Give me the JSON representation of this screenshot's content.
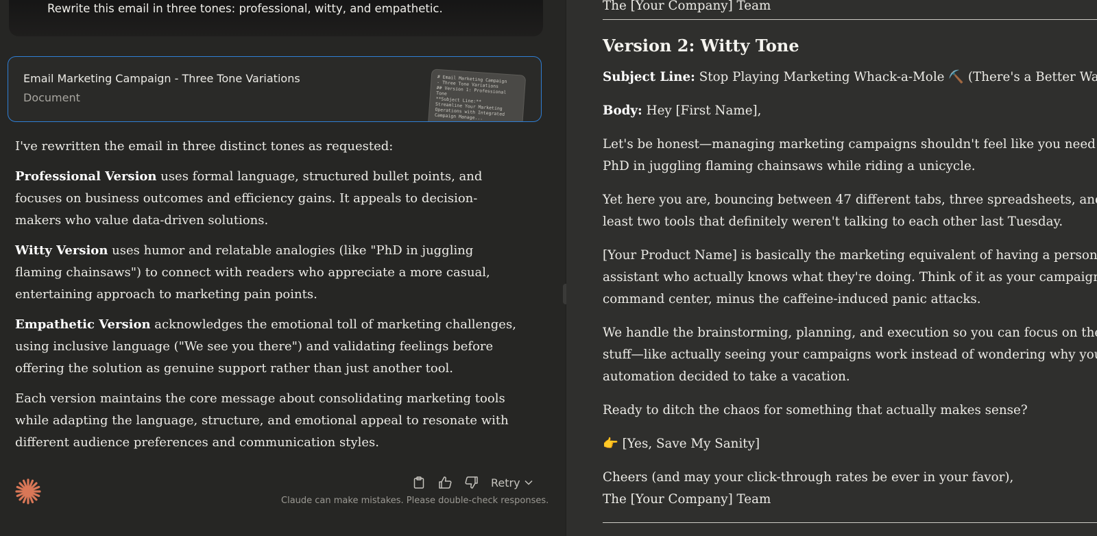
{
  "chat": {
    "user_message": "Rewrite this email in three tones: professional, witty, and empathetic.",
    "artifact": {
      "title": "Email Marketing Campaign - Three Tone Variations",
      "type": "Document",
      "thumbnail_lines": [
        "# Email Marketing Campaign",
        "- Three Tone Variations",
        "",
        "## Version 1: Professional",
        "Tone",
        "",
        "**Subject Line:**",
        "Streamline Your Marketing",
        "Operations with Integrated",
        "Campaign Manage..."
      ]
    },
    "response": {
      "intro": "I've rewritten the email in three distinct tones as requested:",
      "items": [
        {
          "label": "Professional Version",
          "text": " uses formal language, structured bullet points, and focuses on business outcomes and efficiency gains. It appeals to decision-makers who value data-driven solutions."
        },
        {
          "label": "Witty Version",
          "text": " uses humor and relatable analogies (like \"PhD in juggling flaming chainsaws\") to connect with readers who appreciate a more casual, entertaining approach to marketing pain points."
        },
        {
          "label": "Empathetic Version",
          "text": " acknowledges the emotional toll of marketing challenges, using inclusive language (\"We see you there\") and validating feelings before offering the solution as genuine support rather than just another tool."
        }
      ],
      "closing": "Each version maintains the core message about consolidating marketing tools while adapting the language, structure, and emotional appeal to resonate with different audience preferences and communication styles."
    },
    "actions": {
      "copy_icon": "clipboard-icon",
      "like_icon": "thumbs-up-icon",
      "dislike_icon": "thumbs-down-icon",
      "retry_label": "Retry"
    },
    "disclaimer": "Claude can make mistakes. Please double-check responses."
  },
  "document": {
    "prev_signoff": "The [Your Company] Team",
    "version_heading": "Version 2: Witty Tone",
    "subject_label": "Subject Line:",
    "subject_text": " Stop Playing Marketing Whack-a-Mole ⛏️ (There's a Better Way)",
    "body_label": "Body:",
    "body_greeting": " Hey [First Name],",
    "paragraphs": [
      [
        "Let's be honest—managing marketing campaigns shouldn't feel like you need a",
        "PhD in juggling flaming chainsaws while riding a unicycle."
      ],
      [
        "Yet here you are, bouncing between 47 different tabs, three spreadsheets, and at",
        "least two tools that definitely weren't talking to each other last Tuesday."
      ],
      [
        "[Your Product Name] is basically the marketing equivalent of having a personal",
        "assistant who actually knows what they're doing. Think of it as your campaign",
        "command center, minus the caffeine-induced panic attacks."
      ],
      [
        "We handle the brainstorming, planning, and execution so you can focus on the fun",
        "stuff—like actually seeing your campaigns work instead of wondering why your",
        "automation decided to take a vacation."
      ],
      [
        "Ready to ditch the chaos for something that actually makes sense?"
      ],
      [
        "👉 [Yes, Save My Sanity]"
      ],
      [
        "Cheers (and may your click-through rates be ever in your favor),",
        "The [Your Company] Team"
      ]
    ]
  },
  "colors": {
    "accent_border": "#2f7fd6",
    "claude_logo": "#d97757"
  }
}
